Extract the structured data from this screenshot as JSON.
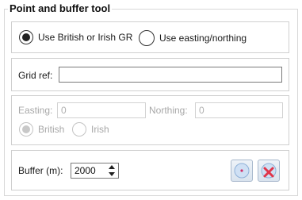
{
  "tool": {
    "title": "Point and buffer tool"
  },
  "grid_system": {
    "option_gr": "Use British or Irish GR",
    "option_en": "Use easting/northing",
    "selected": "gr"
  },
  "grid_ref": {
    "label": "Grid ref:",
    "value": ""
  },
  "easting_northing": {
    "easting_label": "Easting:",
    "easting_value": "0",
    "northing_label": "Northing:",
    "northing_value": "0",
    "option_british": "British",
    "option_irish": "Irish",
    "selected": "british",
    "enabled": false
  },
  "buffer": {
    "label": "Buffer (m):",
    "value": "2000"
  },
  "buttons": {
    "add_point_icon": "point-circle-icon",
    "clear_icon": "red-x-icon"
  },
  "colors": {
    "accent_blue": "#cfe0f4",
    "clear_red": "#e0354a",
    "point_magenta": "#d0306a"
  }
}
